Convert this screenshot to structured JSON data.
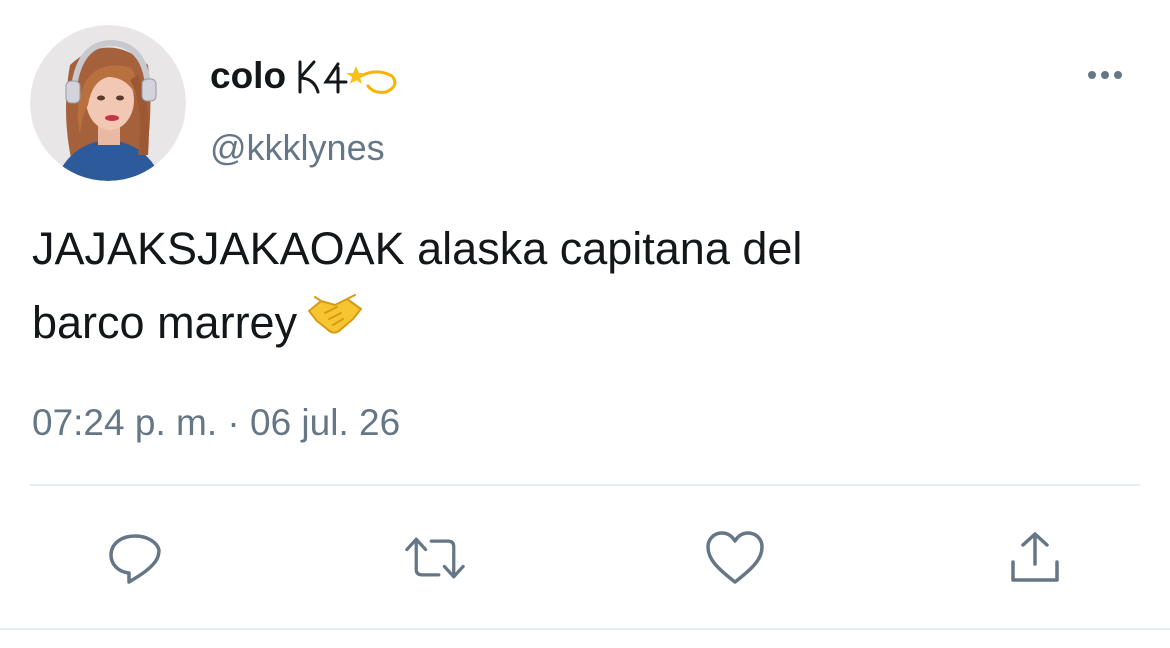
{
  "user": {
    "display_name": "colo",
    "handle": "@kkklynes",
    "avatar_icon": "avatar-photo"
  },
  "tweet": {
    "text_line1": "JAJAKSJAKAOAK alaska capitana del",
    "text_line2": "barco marrey",
    "emoji": "handshake",
    "timestamp": "07:24 p. m. · 06 jul. 26"
  },
  "actions": [
    {
      "icon": "reply-icon"
    },
    {
      "icon": "retweet-icon"
    },
    {
      "icon": "like-icon"
    },
    {
      "icon": "share-icon"
    }
  ],
  "colors": {
    "text": "#14171a",
    "secondary": "#657786",
    "divider": "#e6ecf0"
  }
}
